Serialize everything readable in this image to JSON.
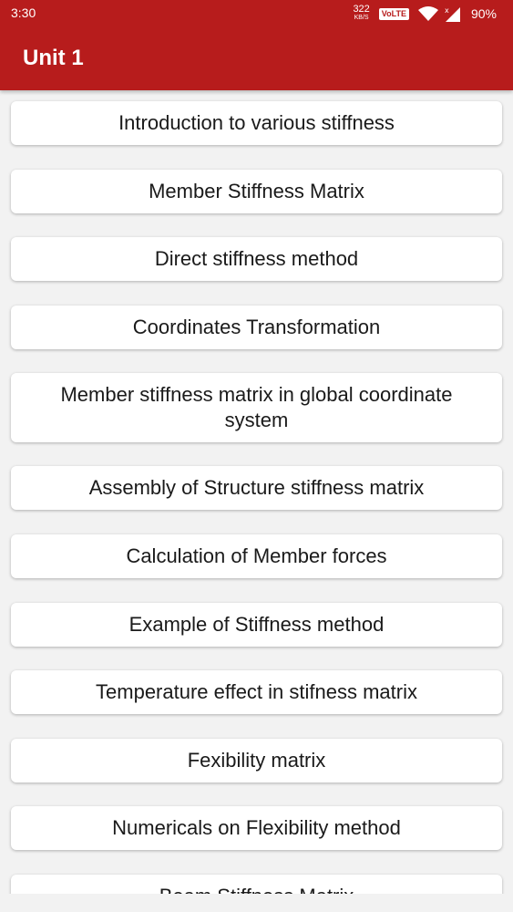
{
  "status_bar": {
    "time": "3:30",
    "net_speed_value": "322",
    "net_speed_unit": "KB/S",
    "volte": "VoLTE",
    "battery": "90%"
  },
  "app_bar": {
    "title": "Unit 1",
    "color": "#b71c1c"
  },
  "topics": [
    "Introduction to various stiffness",
    "Member Stiffness Matrix",
    "Direct stiffness method",
    "Coordinates Transformation",
    "Member stiffness matrix in global coordinate system",
    "Assembly of Structure stiffness matrix",
    "Calculation of Member forces",
    "Example of Stiffness method",
    "Temperature effect in stifness matrix",
    "Fexibility matrix",
    "Numericals on Flexibility method",
    "Beam Stiffness Matrix"
  ]
}
